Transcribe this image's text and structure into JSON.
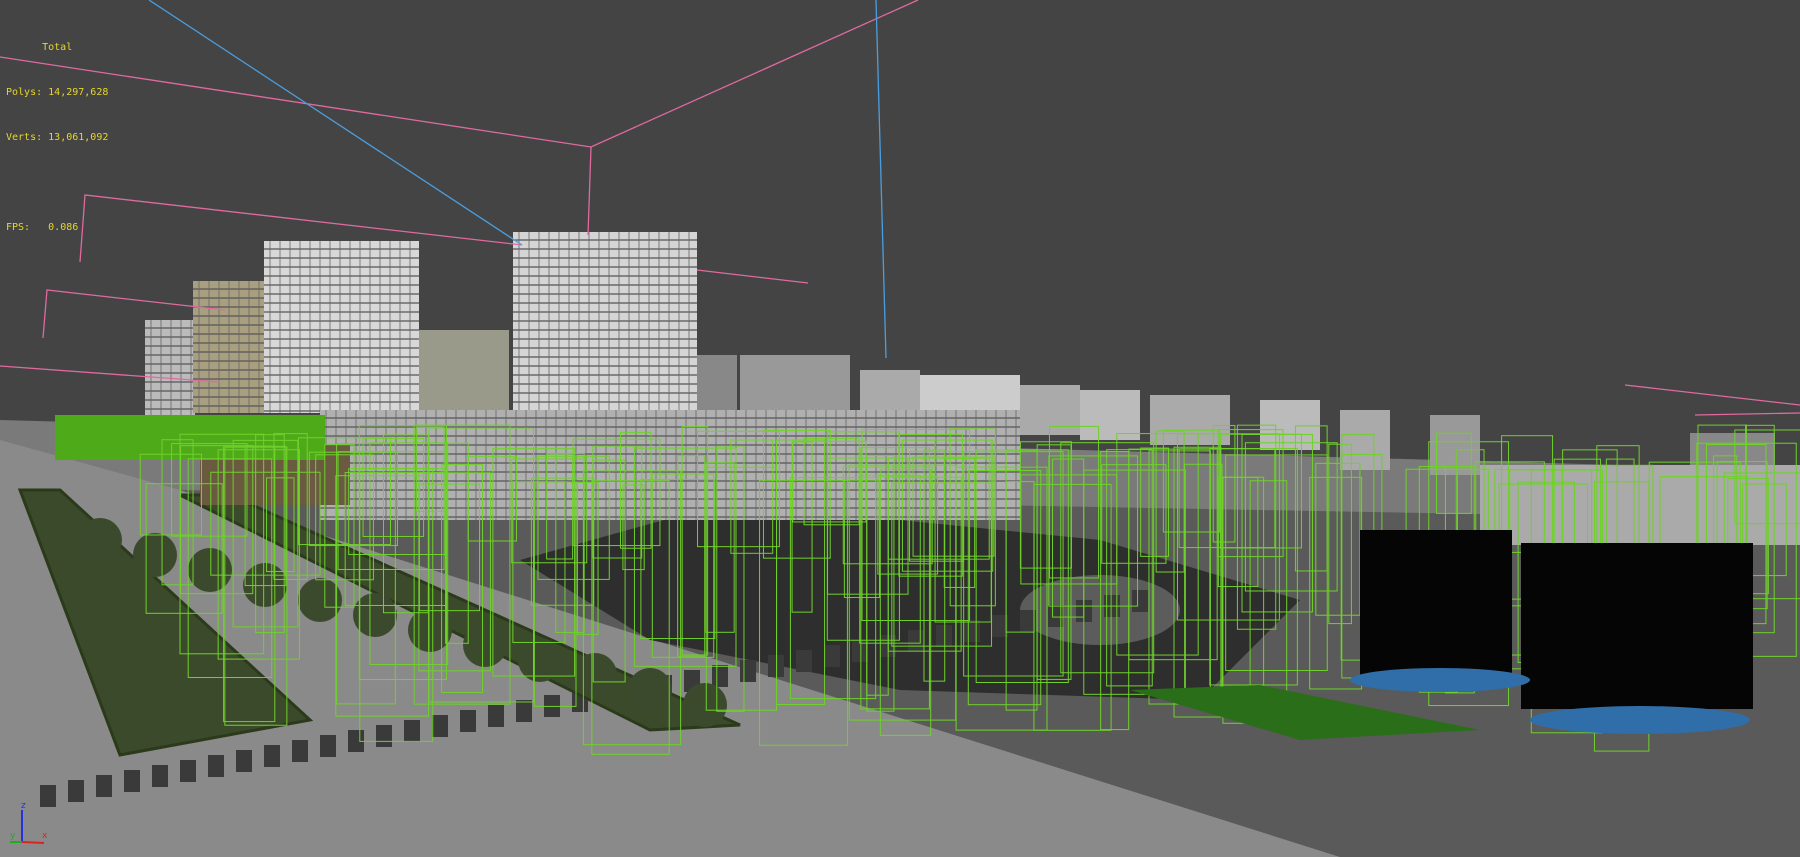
{
  "viewport": {
    "stats": {
      "header": "Total",
      "polys_label": "Polys:",
      "polys_value": "14,297,628",
      "verts_label": "Verts:",
      "verts_value": "13,061,092",
      "fps_label": "FPS:",
      "fps_value": "0.086"
    },
    "gizmo": {
      "x": "x",
      "y": "y",
      "z": "z"
    },
    "colors": {
      "background": "#444444",
      "stats_text": "#e8d62a",
      "selection_wire": "#6fd12a",
      "light_line": "#e06aa0",
      "camera_line": "#4a9ee0"
    }
  }
}
